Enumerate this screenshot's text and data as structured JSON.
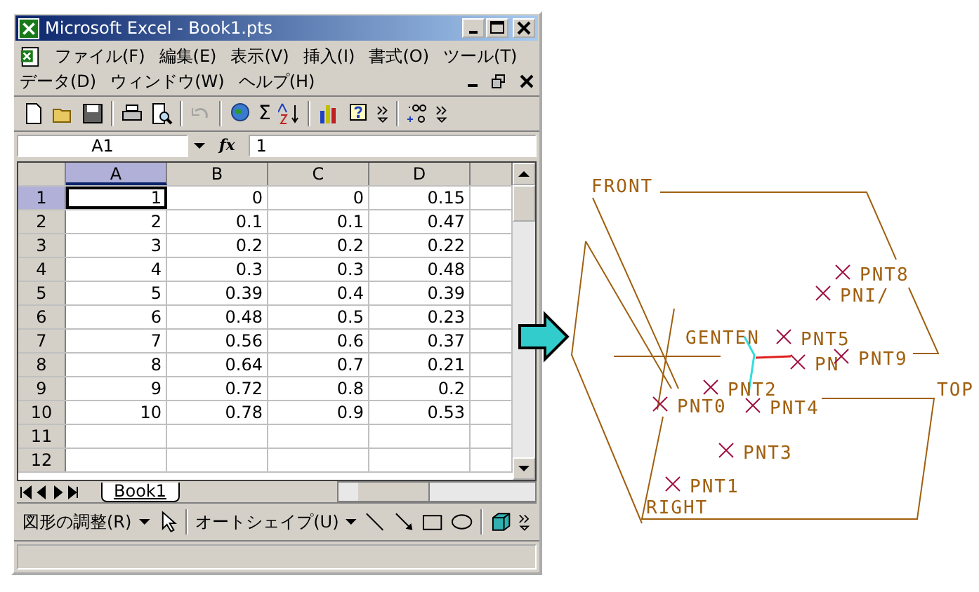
{
  "window": {
    "title": "Microsoft Excel - Book1.pts"
  },
  "menu": [
    {
      "label": "ファイル(F)"
    },
    {
      "label": "編集(E)"
    },
    {
      "label": "表示(V)"
    },
    {
      "label": "挿入(I)"
    },
    {
      "label": "書式(O)"
    },
    {
      "label": "ツール(T)"
    },
    {
      "label": "データ(D)"
    },
    {
      "label": "ウィンドウ(W)"
    },
    {
      "label": "ヘルプ(H)"
    }
  ],
  "toolbar": {
    "sum": "Σ"
  },
  "formula_bar": {
    "name_box": "A1",
    "fx": "fx",
    "value": "1"
  },
  "sheet": {
    "columns": [
      {
        "label": "A",
        "selected": true
      },
      {
        "label": "B",
        "selected": false
      },
      {
        "label": "C",
        "selected": false
      },
      {
        "label": "D",
        "selected": false
      }
    ],
    "rows": [
      {
        "header": "1",
        "selected": true,
        "cells": [
          {
            "value": "1",
            "selected": true
          },
          {
            "value": "0",
            "selected": false
          },
          {
            "value": "0",
            "selected": false
          },
          {
            "value": "0.15",
            "selected": false
          }
        ]
      },
      {
        "header": "2",
        "selected": false,
        "cells": [
          {
            "value": "2",
            "selected": false
          },
          {
            "value": "0.1",
            "selected": false
          },
          {
            "value": "0.1",
            "selected": false
          },
          {
            "value": "0.47",
            "selected": false
          }
        ]
      },
      {
        "header": "3",
        "selected": false,
        "cells": [
          {
            "value": "3",
            "selected": false
          },
          {
            "value": "0.2",
            "selected": false
          },
          {
            "value": "0.2",
            "selected": false
          },
          {
            "value": "0.22",
            "selected": false
          }
        ]
      },
      {
        "header": "4",
        "selected": false,
        "cells": [
          {
            "value": "4",
            "selected": false
          },
          {
            "value": "0.3",
            "selected": false
          },
          {
            "value": "0.3",
            "selected": false
          },
          {
            "value": "0.48",
            "selected": false
          }
        ]
      },
      {
        "header": "5",
        "selected": false,
        "cells": [
          {
            "value": "5",
            "selected": false
          },
          {
            "value": "0.39",
            "selected": false
          },
          {
            "value": "0.4",
            "selected": false
          },
          {
            "value": "0.39",
            "selected": false
          }
        ]
      },
      {
        "header": "6",
        "selected": false,
        "cells": [
          {
            "value": "6",
            "selected": false
          },
          {
            "value": "0.48",
            "selected": false
          },
          {
            "value": "0.5",
            "selected": false
          },
          {
            "value": "0.23",
            "selected": false
          }
        ]
      },
      {
        "header": "7",
        "selected": false,
        "cells": [
          {
            "value": "7",
            "selected": false
          },
          {
            "value": "0.56",
            "selected": false
          },
          {
            "value": "0.6",
            "selected": false
          },
          {
            "value": "0.37",
            "selected": false
          }
        ]
      },
      {
        "header": "8",
        "selected": false,
        "cells": [
          {
            "value": "8",
            "selected": false
          },
          {
            "value": "0.64",
            "selected": false
          },
          {
            "value": "0.7",
            "selected": false
          },
          {
            "value": "0.21",
            "selected": false
          }
        ]
      },
      {
        "header": "9",
        "selected": false,
        "cells": [
          {
            "value": "9",
            "selected": false
          },
          {
            "value": "0.72",
            "selected": false
          },
          {
            "value": "0.8",
            "selected": false
          },
          {
            "value": "0.2",
            "selected": false
          }
        ]
      },
      {
        "header": "10",
        "selected": false,
        "cells": [
          {
            "value": "10",
            "selected": false
          },
          {
            "value": "0.78",
            "selected": false
          },
          {
            "value": "0.9",
            "selected": false
          },
          {
            "value": "0.53",
            "selected": false
          }
        ]
      },
      {
        "header": "11",
        "selected": false
      },
      {
        "header": "12",
        "selected": false
      }
    ]
  },
  "sheet_tabs": [
    {
      "label": "Book1",
      "selected": true
    }
  ],
  "drawing_toolbar": {
    "draw_menu": "図形の調整(R)",
    "autoshape_menu": "オートシェイプ(U)"
  },
  "model": {
    "planes": [
      {
        "label": "FRONT"
      },
      {
        "label": "TOP"
      },
      {
        "label": "RIGHT"
      }
    ],
    "origin": "GENTEN",
    "points": [
      {
        "label": "PNT8"
      },
      {
        "label": "PNI/"
      },
      {
        "label": "PNT5"
      },
      {
        "label": "PN"
      },
      {
        "label": "PNT9"
      },
      {
        "label": "PNT2"
      },
      {
        "label": "PNT0"
      },
      {
        "label": "PNT4"
      },
      {
        "label": "PNT3"
      },
      {
        "label": "PNT1"
      }
    ]
  }
}
